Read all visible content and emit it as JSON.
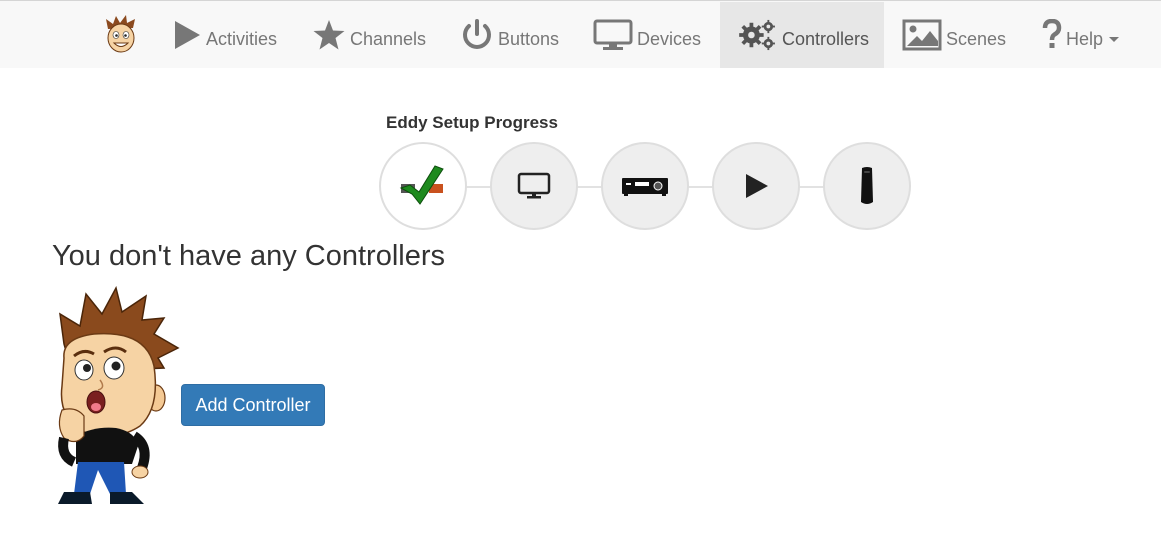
{
  "nav": {
    "items": [
      {
        "label": "Activities",
        "icon": "play-icon"
      },
      {
        "label": "Channels",
        "icon": "star-icon"
      },
      {
        "label": "Buttons",
        "icon": "power-icon"
      },
      {
        "label": "Devices",
        "icon": "monitor-icon"
      },
      {
        "label": "Controllers",
        "icon": "gears-icon",
        "active": true
      },
      {
        "label": "Scenes",
        "icon": "image-icon"
      },
      {
        "label": "Help",
        "icon": "question-icon",
        "dropdown": true
      }
    ]
  },
  "setup": {
    "title": "Eddy Setup Progress",
    "steps": [
      {
        "icon": "device-check-icon",
        "done": true
      },
      {
        "icon": "monitor-icon",
        "done": false
      },
      {
        "icon": "receiver-icon",
        "done": false
      },
      {
        "icon": "play-icon",
        "done": false
      },
      {
        "icon": "remote-icon",
        "done": false
      }
    ]
  },
  "main": {
    "heading": "You don't have any Controllers",
    "add_button": "Add Controller"
  },
  "colors": {
    "primary": "#337ab7",
    "navbar_bg": "#f8f8f8",
    "active_tab": "#e7e7e7",
    "check_green": "#1e8a1e"
  }
}
